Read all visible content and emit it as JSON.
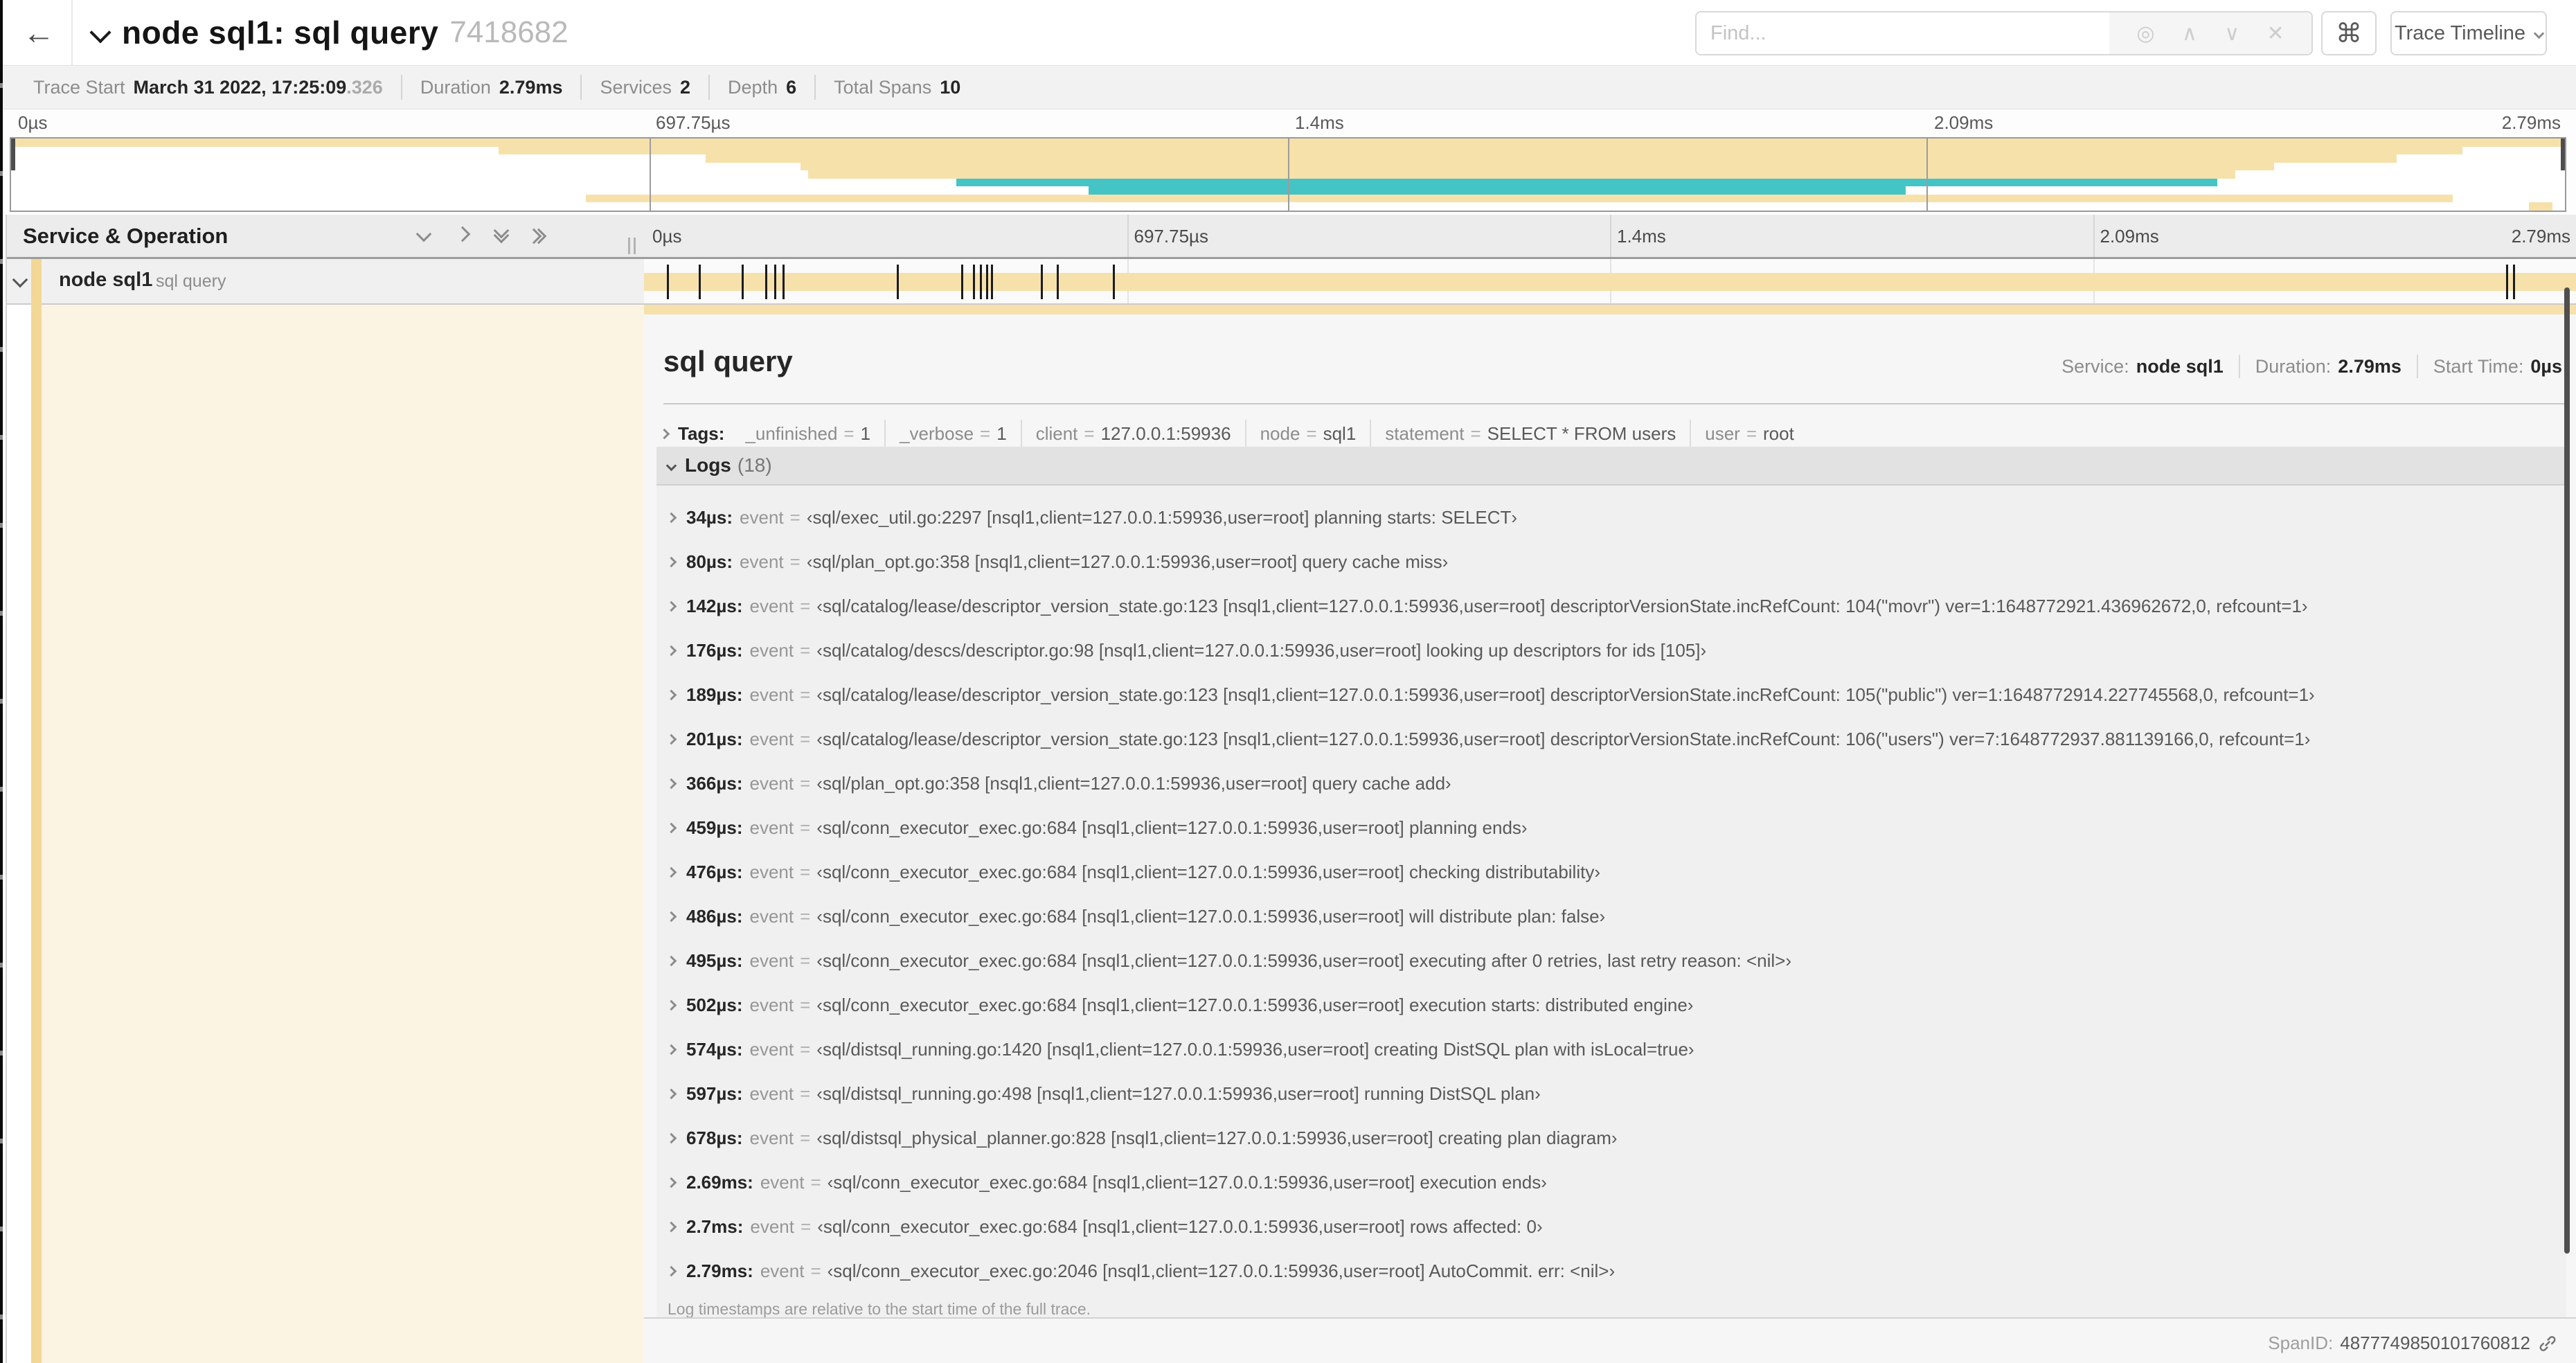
{
  "colors": {
    "tan": "#f7e1ab",
    "tan_accent": "#f3d795",
    "teal": "#45c4c6",
    "tick": "#1b1b1b"
  },
  "header": {
    "back_arrow": "←",
    "title": "node sql1: sql query",
    "trace_id": "7418682",
    "find_placeholder": "Find...",
    "find_icons": {
      "locate": "◎",
      "prev": "∧",
      "next": "∨",
      "clear": "✕"
    },
    "shortcuts_button": "⌘",
    "view_selector_label": "Trace Timeline"
  },
  "trace_stats": [
    {
      "label": "Trace Start",
      "value": "March 31 2022, 17:25:09",
      "suffix": ".326"
    },
    {
      "label": "Duration",
      "value": "2.79ms"
    },
    {
      "label": "Services",
      "value": "2"
    },
    {
      "label": "Depth",
      "value": "6"
    },
    {
      "label": "Total Spans",
      "value": "10"
    }
  ],
  "timeline": {
    "axis_labels": [
      "0µs",
      "697.75µs",
      "1.4ms",
      "2.09ms",
      "2.79ms"
    ]
  },
  "minimap": {
    "bars": [
      {
        "row": 0,
        "start": 0,
        "end": 100,
        "color": "tan"
      },
      {
        "row": 1,
        "start": 19.1,
        "end": 96,
        "color": "tan"
      },
      {
        "row": 2,
        "start": 27.2,
        "end": 93.4,
        "color": "tan"
      },
      {
        "row": 3,
        "start": 30.9,
        "end": 88.6,
        "color": "tan"
      },
      {
        "row": 4,
        "start": 31.2,
        "end": 87.1,
        "color": "tan"
      },
      {
        "row": 5,
        "start": 37.0,
        "end": 86.4,
        "color": "teal"
      },
      {
        "row": 6,
        "start": 42.2,
        "end": 74.2,
        "color": "teal"
      },
      {
        "row": 7,
        "start": 22.5,
        "end": 95.6,
        "color": "tan"
      },
      {
        "row": 8,
        "start": 98.6,
        "end": 99.5,
        "color": "tan"
      }
    ]
  },
  "grid_header": {
    "left_title": "Service & Operation"
  },
  "span_row": {
    "service": "node sql1",
    "operation": "sql query",
    "duration_us": 2790,
    "ticks_us": [
      34,
      80,
      142,
      176,
      189,
      201,
      366,
      459,
      476,
      486,
      495,
      502,
      574,
      597,
      678,
      2690,
      2700
    ]
  },
  "detail": {
    "title": "sql query",
    "meta": [
      {
        "label": "Service:",
        "value": "node sql1"
      },
      {
        "label": "Duration:",
        "value": "2.79ms"
      },
      {
        "label": "Start Time:",
        "value": "0µs"
      }
    ],
    "tags_label": "Tags:",
    "tags": [
      {
        "key": "_unfinished",
        "value": "1"
      },
      {
        "key": "_verbose",
        "value": "1"
      },
      {
        "key": "client",
        "value": "127.0.0.1:59936"
      },
      {
        "key": "node",
        "value": "sql1"
      },
      {
        "key": "statement",
        "value": "SELECT * FROM users"
      },
      {
        "key": "user",
        "value": "root"
      }
    ],
    "logs_title": "Logs",
    "logs_count": "(18)",
    "logs": [
      {
        "time": "34µs:",
        "field": "event",
        "value": "‹sql/exec_util.go:2297 [nsql1,client=127.0.0.1:59936,user=root] planning starts: SELECT›"
      },
      {
        "time": "80µs:",
        "field": "event",
        "value": "‹sql/plan_opt.go:358 [nsql1,client=127.0.0.1:59936,user=root] query cache miss›"
      },
      {
        "time": "142µs:",
        "field": "event",
        "value": "‹sql/catalog/lease/descriptor_version_state.go:123 [nsql1,client=127.0.0.1:59936,user=root] descriptorVersionState.incRefCount: 104(\"movr\") ver=1:1648772921.436962672,0, refcount=1›"
      },
      {
        "time": "176µs:",
        "field": "event",
        "value": "‹sql/catalog/descs/descriptor.go:98 [nsql1,client=127.0.0.1:59936,user=root] looking up descriptors for ids [105]›"
      },
      {
        "time": "189µs:",
        "field": "event",
        "value": "‹sql/catalog/lease/descriptor_version_state.go:123 [nsql1,client=127.0.0.1:59936,user=root] descriptorVersionState.incRefCount: 105(\"public\") ver=1:1648772914.227745568,0, refcount=1›"
      },
      {
        "time": "201µs:",
        "field": "event",
        "value": "‹sql/catalog/lease/descriptor_version_state.go:123 [nsql1,client=127.0.0.1:59936,user=root] descriptorVersionState.incRefCount: 106(\"users\") ver=7:1648772937.881139166,0, refcount=1›"
      },
      {
        "time": "366µs:",
        "field": "event",
        "value": "‹sql/plan_opt.go:358 [nsql1,client=127.0.0.1:59936,user=root] query cache add›"
      },
      {
        "time": "459µs:",
        "field": "event",
        "value": "‹sql/conn_executor_exec.go:684 [nsql1,client=127.0.0.1:59936,user=root] planning ends›"
      },
      {
        "time": "476µs:",
        "field": "event",
        "value": "‹sql/conn_executor_exec.go:684 [nsql1,client=127.0.0.1:59936,user=root] checking distributability›"
      },
      {
        "time": "486µs:",
        "field": "event",
        "value": "‹sql/conn_executor_exec.go:684 [nsql1,client=127.0.0.1:59936,user=root] will distribute plan: false›"
      },
      {
        "time": "495µs:",
        "field": "event",
        "value": "‹sql/conn_executor_exec.go:684 [nsql1,client=127.0.0.1:59936,user=root] executing after 0 retries, last retry reason: <nil>›"
      },
      {
        "time": "502µs:",
        "field": "event",
        "value": "‹sql/conn_executor_exec.go:684 [nsql1,client=127.0.0.1:59936,user=root] execution starts: distributed engine›"
      },
      {
        "time": "574µs:",
        "field": "event",
        "value": "‹sql/distsql_running.go:1420 [nsql1,client=127.0.0.1:59936,user=root] creating DistSQL plan with isLocal=true›"
      },
      {
        "time": "597µs:",
        "field": "event",
        "value": "‹sql/distsql_running.go:498 [nsql1,client=127.0.0.1:59936,user=root] running DistSQL plan›"
      },
      {
        "time": "678µs:",
        "field": "event",
        "value": "‹sql/distsql_physical_planner.go:828 [nsql1,client=127.0.0.1:59936,user=root] creating plan diagram›"
      },
      {
        "time": "2.69ms:",
        "field": "event",
        "value": "‹sql/conn_executor_exec.go:684 [nsql1,client=127.0.0.1:59936,user=root] execution ends›"
      },
      {
        "time": "2.7ms:",
        "field": "event",
        "value": "‹sql/conn_executor_exec.go:684 [nsql1,client=127.0.0.1:59936,user=root] rows affected: 0›"
      },
      {
        "time": "2.79ms:",
        "field": "event",
        "value": "‹sql/conn_executor_exec.go:2046 [nsql1,client=127.0.0.1:59936,user=root] AutoCommit. err: <nil>›"
      }
    ],
    "logs_footnote": "Log timestamps are relative to the start time of the full trace.",
    "span_id_label": "SpanID:",
    "span_id": "4877749850101760812"
  },
  "misc": {
    "eq": "="
  }
}
